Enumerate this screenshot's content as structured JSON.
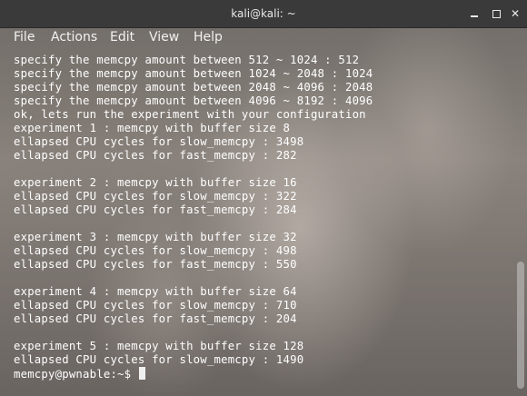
{
  "window": {
    "title": "kali@kali: ~",
    "buttons": {
      "minimize": "minimize-icon",
      "maximize": "maximize-icon",
      "close": "✕"
    }
  },
  "menu": {
    "items": [
      "File",
      "Actions",
      "Edit",
      "View",
      "Help"
    ]
  },
  "terminal": {
    "lines": [
      "specify the memcpy amount between 512 ~ 1024 : 512",
      "specify the memcpy amount between 1024 ~ 2048 : 1024",
      "specify the memcpy amount between 2048 ~ 4096 : 2048",
      "specify the memcpy amount between 4096 ~ 8192 : 4096",
      "ok, lets run the experiment with your configuration",
      "experiment 1 : memcpy with buffer size 8",
      "ellapsed CPU cycles for slow_memcpy : 3498",
      "ellapsed CPU cycles for fast_memcpy : 282",
      "",
      "experiment 2 : memcpy with buffer size 16",
      "ellapsed CPU cycles for slow_memcpy : 322",
      "ellapsed CPU cycles for fast_memcpy : 284",
      "",
      "experiment 3 : memcpy with buffer size 32",
      "ellapsed CPU cycles for slow_memcpy : 498",
      "ellapsed CPU cycles for fast_memcpy : 550",
      "",
      "experiment 4 : memcpy with buffer size 64",
      "ellapsed CPU cycles for slow_memcpy : 710",
      "ellapsed CPU cycles for fast_memcpy : 204",
      "",
      "experiment 5 : memcpy with buffer size 128",
      "ellapsed CPU cycles for slow_memcpy : 1490"
    ],
    "prompt": "memcpy@pwnable:~$ "
  },
  "colors": {
    "titlebar": "#3a3a3a",
    "text": "#ffffff"
  }
}
